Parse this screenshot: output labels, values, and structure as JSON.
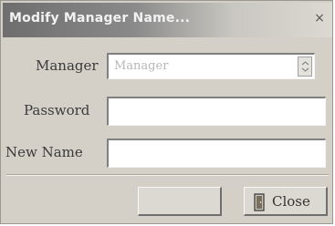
{
  "window": {
    "title": "Modify Manager Name...",
    "close_glyph": "×"
  },
  "form": {
    "manager_label": "Manager",
    "manager_value": "Manager",
    "password_label": "Password",
    "new_name_label": "New Name",
    "password_value": "",
    "new_name_value": ""
  },
  "buttons": {
    "ok_label": "",
    "close_label": "Close"
  },
  "icons": {
    "dropdown": "chevron-down-icon",
    "close_button_icon": "door-exit-icon",
    "title_close": "close-icon"
  }
}
